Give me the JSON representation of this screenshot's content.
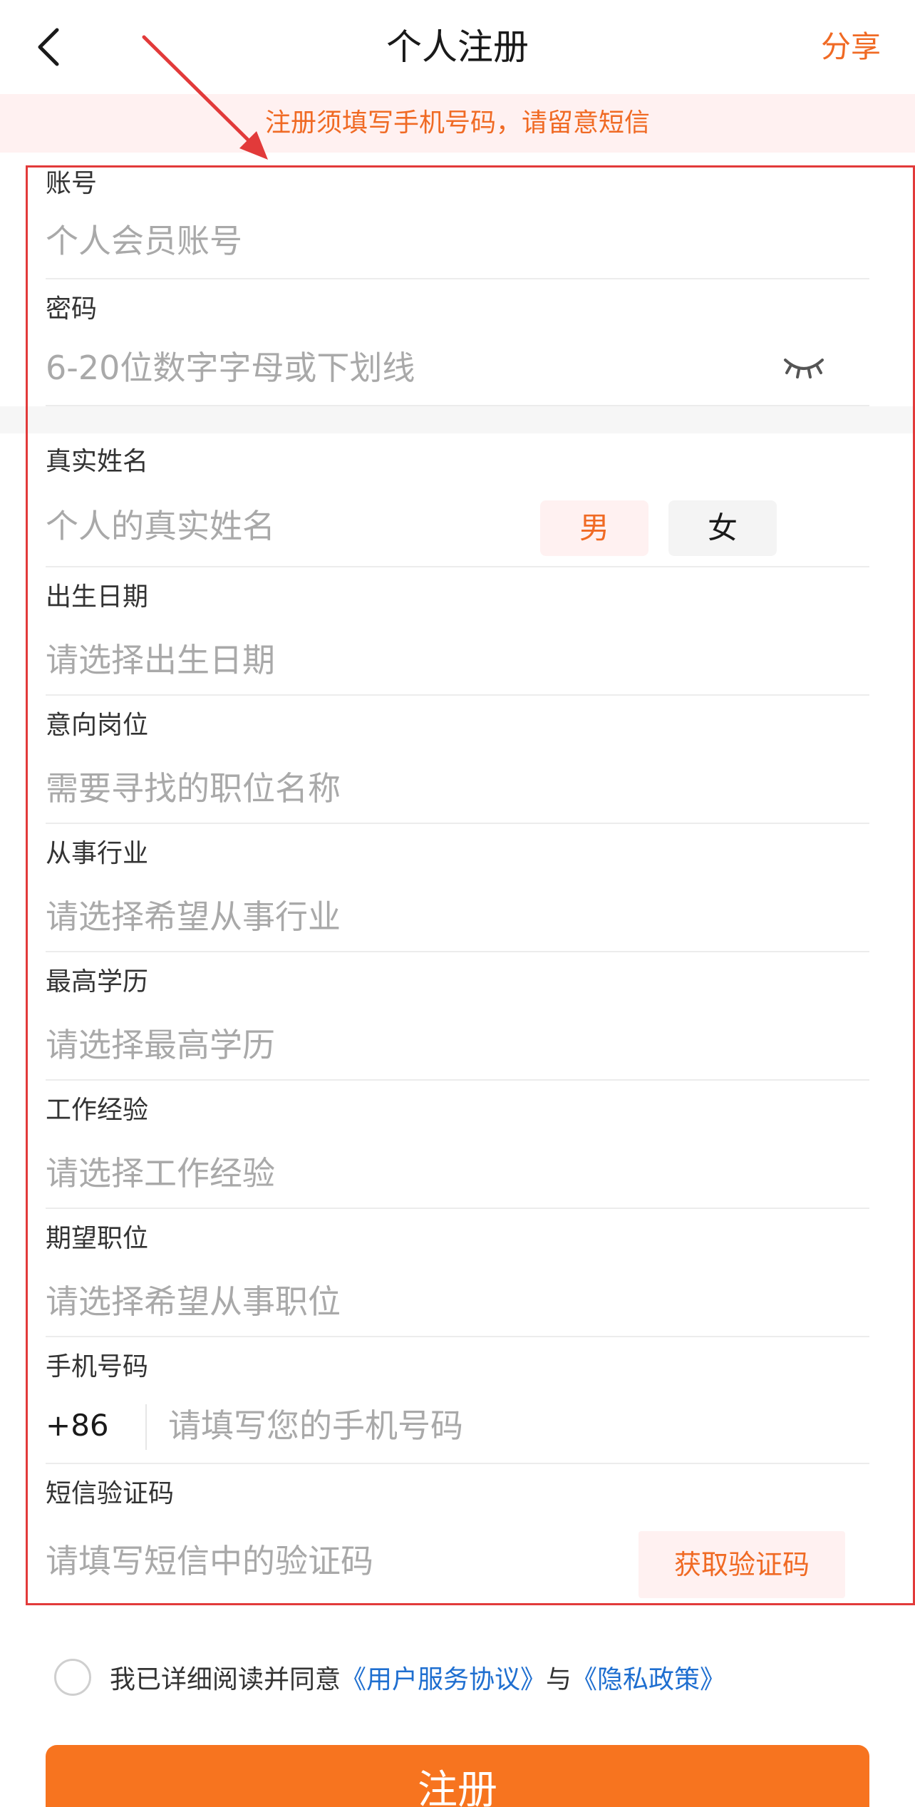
{
  "header": {
    "title": "个人注册",
    "share_label": "分享"
  },
  "notice": {
    "text": "注册须填写手机号码，请留意短信"
  },
  "form": {
    "account": {
      "label": "账号",
      "placeholder": "个人会员账号"
    },
    "password": {
      "label": "密码",
      "placeholder": "6-20位数字字母或下划线",
      "eye_icon": "eye-closed-icon"
    },
    "real_name": {
      "label": "真实姓名",
      "placeholder": "个人的真实姓名",
      "male": "男",
      "female": "女"
    },
    "birth_date": {
      "label": "出生日期",
      "placeholder": "请选择出生日期"
    },
    "intended_position": {
      "label": "意向岗位",
      "placeholder": "需要寻找的职位名称"
    },
    "industry": {
      "label": "从事行业",
      "placeholder": "请选择希望从事行业"
    },
    "education": {
      "label": "最高学历",
      "placeholder": "请选择最高学历"
    },
    "experience": {
      "label": "工作经验",
      "placeholder": "请选择工作经验"
    },
    "expected_position": {
      "label": "期望职位",
      "placeholder": "请选择希望从事职位"
    },
    "phone": {
      "label": "手机号码",
      "prefix": "+86",
      "placeholder": "请填写您的手机号码"
    },
    "sms_code": {
      "label": "短信验证码",
      "placeholder": "请填写短信中的验证码",
      "button": "获取验证码"
    }
  },
  "agreement": {
    "prefix": "我已详细阅读并同意",
    "terms": "《用户服务协议》",
    "joiner": "与",
    "privacy": "《隐私政策》"
  },
  "submit": {
    "label": "注册"
  },
  "colors": {
    "accent": "#f06a24",
    "button": "#f7741f",
    "link": "#1f6fd0",
    "annotation": "#e23a3a"
  }
}
